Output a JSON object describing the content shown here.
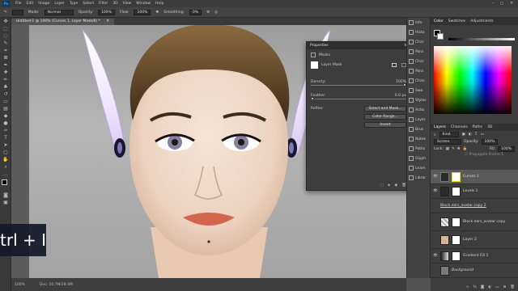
{
  "menubar": {
    "app_icon": "Ps",
    "items": [
      "File",
      "Edit",
      "Image",
      "Layer",
      "Type",
      "Select",
      "Filter",
      "3D",
      "View",
      "Window",
      "Help"
    ],
    "controls": [
      "–",
      "□",
      "✕"
    ]
  },
  "options": {
    "mode_label": "Mode:",
    "mode_value": "Normal",
    "opacity_label": "Opacity:",
    "opacity_value": "100%",
    "flow_label": "Flow:",
    "flow_value": "100%",
    "smoothing_label": "Smoothing:",
    "smoothing_value": "0%"
  },
  "document": {
    "tab_title": "Untitled-1 @ 100% (Curves 1, Layer Mask/8) *",
    "status_zoom": "100%",
    "status_doc": "Doc: 10.7M/28.4M"
  },
  "properties": {
    "title": "Properties",
    "subtitle": "Masks",
    "mask_name": "Layer Mask",
    "density_label": "Density:",
    "density_value": "100%",
    "density_fraction": 1.0,
    "feather_label": "Feather:",
    "feather_value": "0.0 px",
    "feather_fraction": 0.0,
    "refine_label": "Refine:",
    "select_mask_btn": "Select and Mask...",
    "color_range_btn": "Color Range...",
    "invert_btn": "Invert"
  },
  "panel_strip": {
    "items": [
      "Info",
      "Histo",
      "Char",
      "Para",
      "Char",
      "Para",
      "Chan",
      "Swa",
      "Styles",
      "Actio",
      "Layer",
      "Brus",
      "Notes",
      "Paths",
      "Glyph",
      "Learn",
      "Librar"
    ]
  },
  "color_panel": {
    "tabs": [
      "Color",
      "Swatches",
      "Adjustments"
    ],
    "accent": "#ff0000"
  },
  "layers_panel": {
    "tabs": [
      "Layers",
      "Channels",
      "Paths",
      "3D"
    ],
    "kind_label": "Kind",
    "blend_mode": "Screen",
    "opacity_label": "Opacity:",
    "opacity_value": "100%",
    "lock_label": "Lock:",
    "fill_label": "Fill:",
    "fill_value": "100%",
    "propagate_label": "Propagate Frame 1",
    "layers": [
      {
        "name": "Curves 1",
        "selected": true
      },
      {
        "name": "Levels 1",
        "selected": false
      },
      {
        "name": "Block ears_avatar copy 2",
        "selected": false
      },
      {
        "name": "Block ears_avatar copy",
        "selected": false
      },
      {
        "name": "Layer 2",
        "selected": false
      },
      {
        "name": "Gradient Fill 1",
        "selected": false
      },
      {
        "name": "Background",
        "selected": false
      }
    ]
  },
  "overlay": {
    "shortcut_text": "trl + I"
  }
}
